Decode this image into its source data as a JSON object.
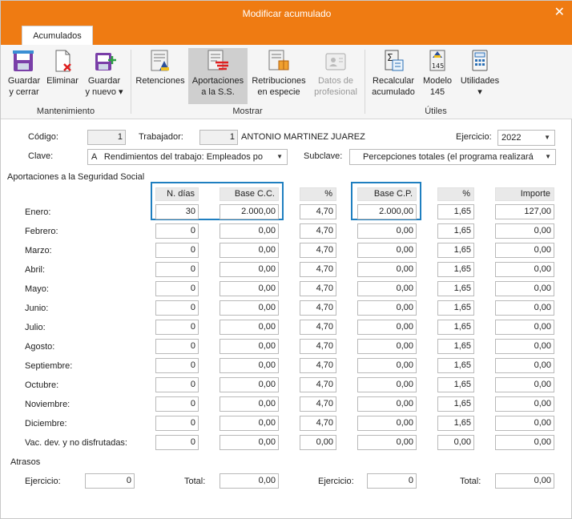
{
  "window": {
    "title": "Modificar acumulado",
    "close_glyph": "✕"
  },
  "tabs": [
    {
      "label": "Acumulados"
    }
  ],
  "ribbon": {
    "groups": [
      {
        "label": "Mantenimiento"
      },
      {
        "label": "Mostrar"
      },
      {
        "label": "Útiles"
      }
    ],
    "buttons": {
      "guardar_cerrar": [
        "Guardar",
        "y cerrar"
      ],
      "eliminar": [
        "Eliminar"
      ],
      "guardar_nuevo": [
        "Guardar",
        "y nuevo ▾"
      ],
      "retenciones": [
        "Retenciones"
      ],
      "aportaciones": [
        "Aportaciones",
        "a la S.S."
      ],
      "retribuciones": [
        "Retribuciones",
        "en especie"
      ],
      "datos_profesional": [
        "Datos de",
        "profesional"
      ],
      "recalcular": [
        "Recalcular",
        "acumulado"
      ],
      "modelo145": [
        "Modelo",
        "145"
      ],
      "utilidades": [
        "Utilidades",
        "▾"
      ]
    }
  },
  "form": {
    "codigo_label": "Código:",
    "codigo_value": "1",
    "trabajador_label": "Trabajador:",
    "trabajador_value": "1",
    "trabajador_name": "ANTONIO MARTINEZ JUAREZ",
    "ejercicio_label": "Ejercicio:",
    "ejercicio_value": "2022",
    "clave_label": "Clave:",
    "clave_value": "A   Rendimientos del trabajo: Empleados po",
    "subclave_label": "Subclave:",
    "subclave_value": "Percepciones totales (el programa realizará",
    "section_title": "Aportaciones a la Seguridad Social"
  },
  "table": {
    "headers": [
      "N. días",
      "Base C.C.",
      "%",
      "Base C.P.",
      "%",
      "Importe"
    ],
    "rows": [
      {
        "month": "Enero:",
        "cells": [
          "30",
          "2.000,00",
          "4,70",
          "2.000,00",
          "1,65",
          "127,00"
        ]
      },
      {
        "month": "Febrero:",
        "cells": [
          "0",
          "0,00",
          "4,70",
          "0,00",
          "1,65",
          "0,00"
        ]
      },
      {
        "month": "Marzo:",
        "cells": [
          "0",
          "0,00",
          "4,70",
          "0,00",
          "1,65",
          "0,00"
        ]
      },
      {
        "month": "Abril:",
        "cells": [
          "0",
          "0,00",
          "4,70",
          "0,00",
          "1,65",
          "0,00"
        ]
      },
      {
        "month": "Mayo:",
        "cells": [
          "0",
          "0,00",
          "4,70",
          "0,00",
          "1,65",
          "0,00"
        ]
      },
      {
        "month": "Junio:",
        "cells": [
          "0",
          "0,00",
          "4,70",
          "0,00",
          "1,65",
          "0,00"
        ]
      },
      {
        "month": "Julio:",
        "cells": [
          "0",
          "0,00",
          "4,70",
          "0,00",
          "1,65",
          "0,00"
        ]
      },
      {
        "month": "Agosto:",
        "cells": [
          "0",
          "0,00",
          "4,70",
          "0,00",
          "1,65",
          "0,00"
        ]
      },
      {
        "month": "Septiembre:",
        "cells": [
          "0",
          "0,00",
          "4,70",
          "0,00",
          "1,65",
          "0,00"
        ]
      },
      {
        "month": "Octubre:",
        "cells": [
          "0",
          "0,00",
          "4,70",
          "0,00",
          "1,65",
          "0,00"
        ]
      },
      {
        "month": "Noviembre:",
        "cells": [
          "0",
          "0,00",
          "4,70",
          "0,00",
          "1,65",
          "0,00"
        ]
      },
      {
        "month": "Diciembre:",
        "cells": [
          "0",
          "0,00",
          "4,70",
          "0,00",
          "1,65",
          "0,00"
        ]
      },
      {
        "month": "Vac. dev. y no disfrutadas:",
        "cells": [
          "0",
          "0,00",
          "0,00",
          "0,00",
          "0,00",
          "0,00"
        ]
      }
    ]
  },
  "atrasos": {
    "title": "Atrasos",
    "ejercicio1_label": "Ejercicio:",
    "ejercicio1_value": "0",
    "total1_label": "Total:",
    "total1_value": "0,00",
    "ejercicio2_label": "Ejercicio:",
    "ejercicio2_value": "0",
    "total2_label": "Total:",
    "total2_value": "0,00"
  },
  "colors": {
    "titlebar": "#ef7b12",
    "highlight": "#1f7fc0",
    "header_bg": "#e9e9e9"
  }
}
